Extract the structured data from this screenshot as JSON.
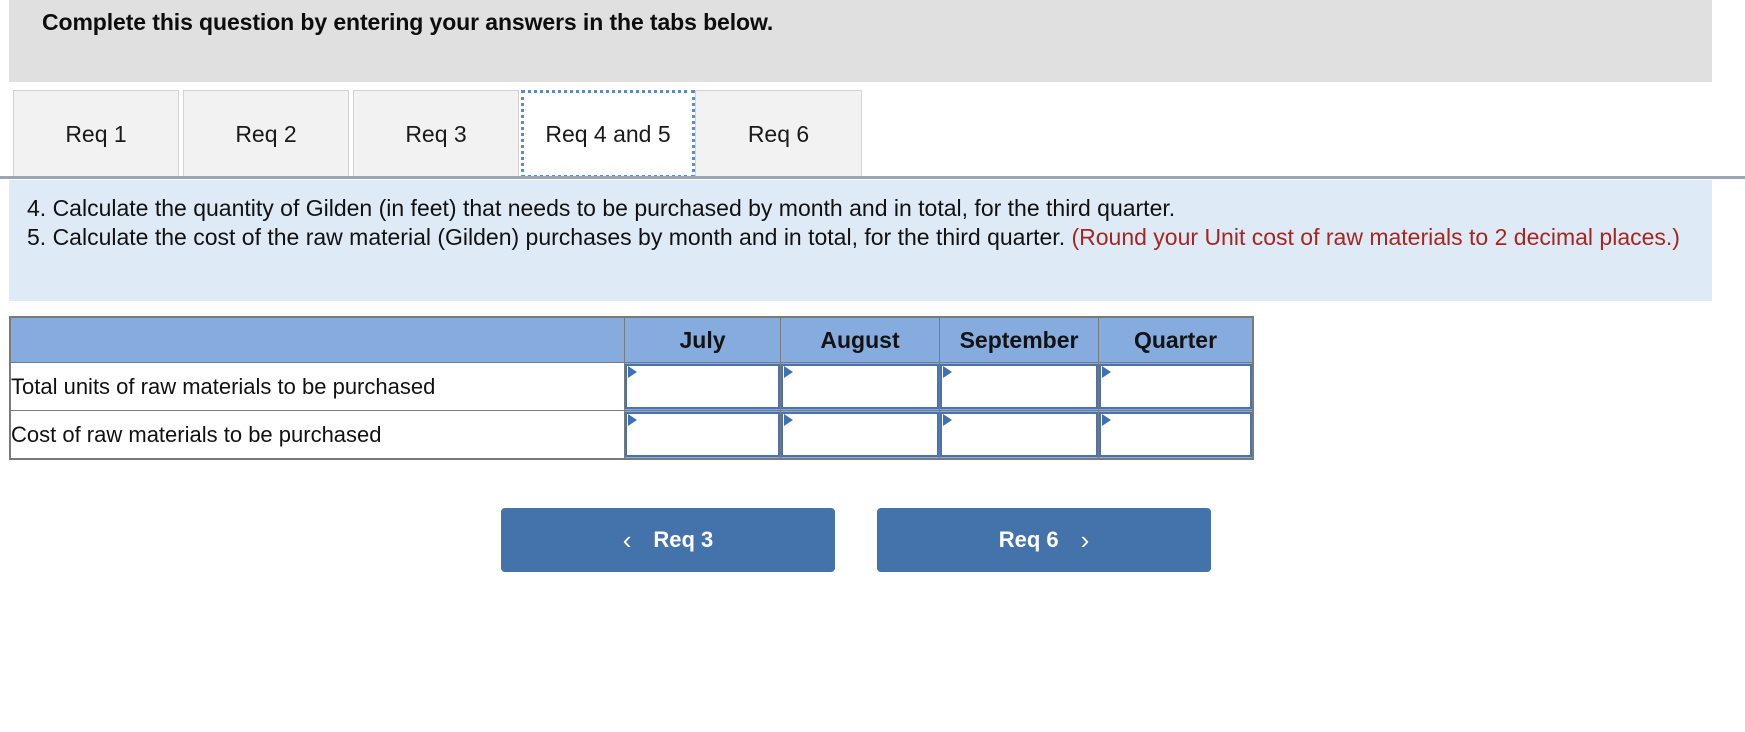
{
  "banner": {
    "title": "Complete this question by entering your answers in the tabs below."
  },
  "tabs": [
    {
      "label": "Req 1",
      "active": false
    },
    {
      "label": "Req 2",
      "active": false
    },
    {
      "label": "Req 3",
      "active": false
    },
    {
      "label": "Req 4 and 5",
      "active": true
    },
    {
      "label": "Req 6",
      "active": false
    }
  ],
  "instructions": {
    "line4": "4. Calculate the quantity of Gilden (in feet) that needs to be purchased by month and in total, for the third quarter.",
    "line5_main": "5. Calculate the cost of the raw material (Gilden) purchases by month and in total, for the third quarter. ",
    "line5_note": "(Round your Unit cost of raw materials to 2 decimal places.)"
  },
  "table": {
    "columns": [
      "",
      "July",
      "August",
      "September",
      "Quarter"
    ],
    "rows": [
      {
        "label": "Total units of raw materials to be purchased",
        "values": [
          "",
          "",
          "",
          ""
        ]
      },
      {
        "label": "Cost of raw materials to be purchased",
        "values": [
          "",
          "",
          "",
          ""
        ]
      }
    ]
  },
  "nav": {
    "prev_label": "Req 3",
    "next_label": "Req 6",
    "prev_icon": "chevron-left-icon",
    "next_icon": "chevron-right-icon",
    "prev_chevron": "‹",
    "next_chevron": "›"
  },
  "colors": {
    "banner_bg": "#e0e0e0",
    "instructions_bg": "#dfeaf7",
    "note_red": "#a52620",
    "table_header_blue": "#85abdf",
    "input_border_blue": "#4a72b0",
    "button_blue": "#4472ab",
    "tab_focus_blue": "#5b8ac7"
  }
}
